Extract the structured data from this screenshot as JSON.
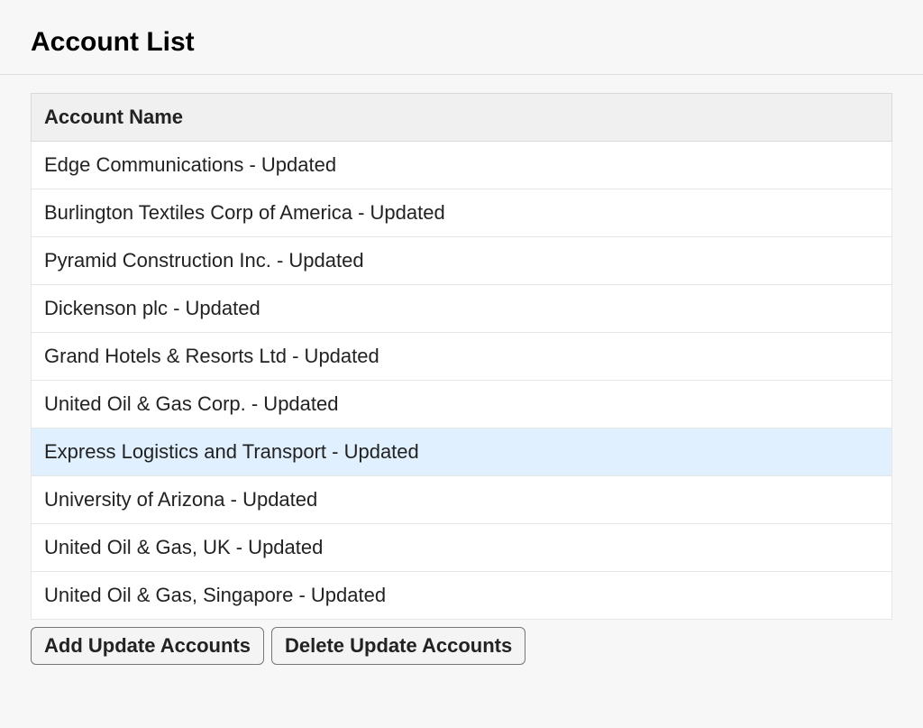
{
  "page": {
    "title": "Account List"
  },
  "table": {
    "header": "Account Name",
    "rows": [
      {
        "name": "Edge Communications - Updated",
        "highlighted": false
      },
      {
        "name": "Burlington Textiles Corp of America - Updated",
        "highlighted": false
      },
      {
        "name": "Pyramid Construction Inc. - Updated",
        "highlighted": false
      },
      {
        "name": "Dickenson plc - Updated",
        "highlighted": false
      },
      {
        "name": "Grand Hotels & Resorts Ltd - Updated",
        "highlighted": false
      },
      {
        "name": "United Oil & Gas Corp. - Updated",
        "highlighted": false
      },
      {
        "name": "Express Logistics and Transport - Updated",
        "highlighted": true
      },
      {
        "name": "University of Arizona - Updated",
        "highlighted": false
      },
      {
        "name": "United Oil & Gas, UK - Updated",
        "highlighted": false
      },
      {
        "name": "United Oil & Gas, Singapore - Updated",
        "highlighted": false
      }
    ]
  },
  "buttons": {
    "add_update": "Add Update Accounts",
    "delete_update": "Delete Update Accounts"
  }
}
